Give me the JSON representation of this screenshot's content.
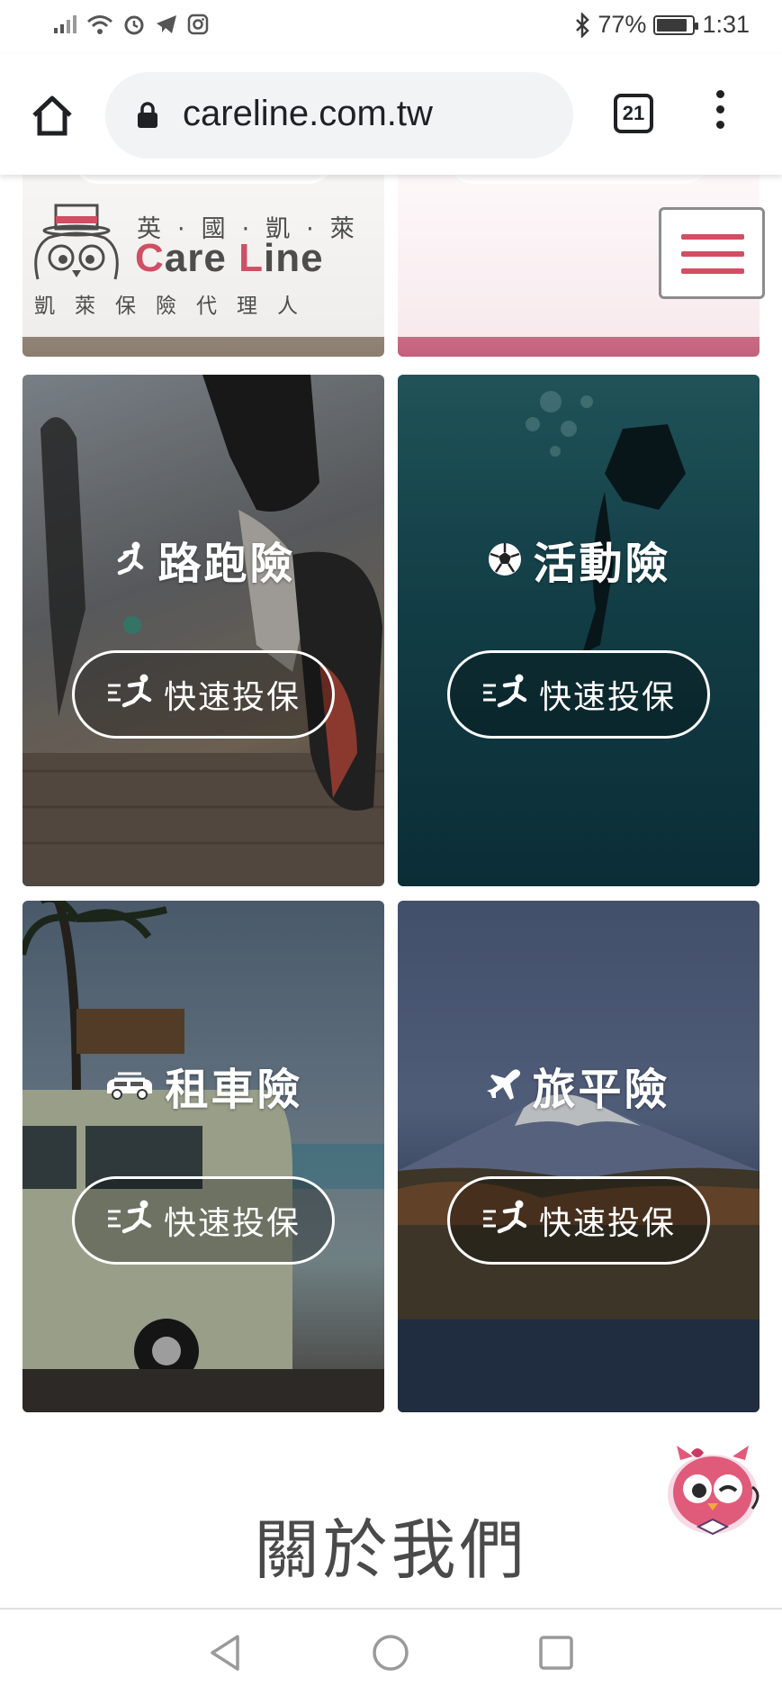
{
  "status_bar": {
    "battery": "77%",
    "battery_level": 0.77,
    "time": "1:31"
  },
  "browser": {
    "url": "careline.com.tw",
    "tab_count": "21"
  },
  "header": {
    "logo_top": "英·國·凱·萊",
    "logo_brand_c": "C",
    "logo_brand_rest": "are ",
    "logo_brand_l": "L",
    "logo_brand_rest2": "ine",
    "logo_bottom": "凱萊保險代理人"
  },
  "cards": [
    {
      "title": "路跑險",
      "button": "快速投保",
      "icon": "runner-icon"
    },
    {
      "title": "活動險",
      "button": "快速投保",
      "icon": "soccer-ball-icon"
    },
    {
      "title": "租車險",
      "button": "快速投保",
      "icon": "car-icon"
    },
    {
      "title": "旅平險",
      "button": "快速投保",
      "icon": "airplane-icon"
    }
  ],
  "about": {
    "title": "關於我們"
  },
  "colors": {
    "brand_pink": "#d14e63",
    "text_dark": "#4a4a4a"
  }
}
